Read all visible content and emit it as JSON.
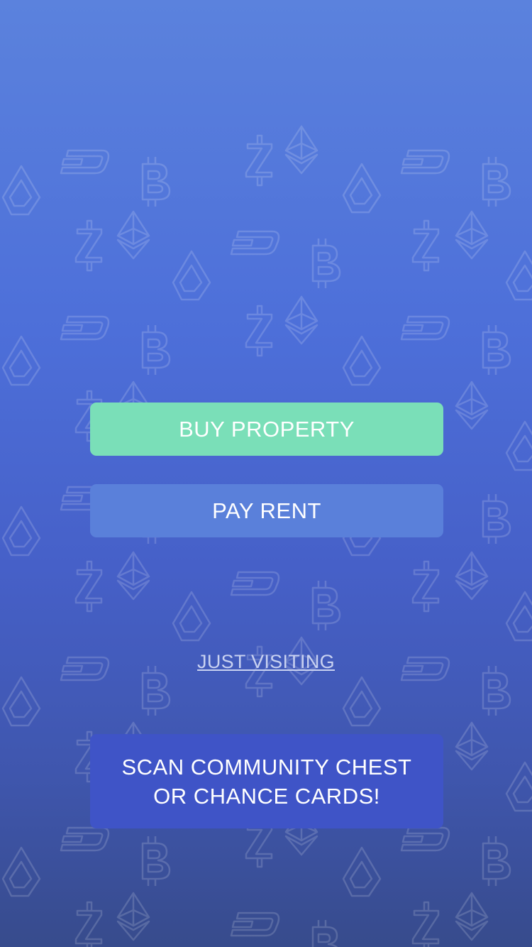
{
  "actions": {
    "buy_property": "BUY PROPERTY",
    "pay_rent": "PAY RENT",
    "just_visiting": "JUST VISITING",
    "scan_line1": "SCAN COMMUNITY CHEST",
    "scan_line2": "OR CHANCE CARDS!"
  },
  "colors": {
    "buy_button": "#7adfb8",
    "rent_button": "#5a80da",
    "scan_button": "#3f54c7",
    "background_top": "#5b82dd",
    "background_bottom": "#374b8c"
  },
  "background_icons": [
    "bitcoin-icon",
    "ethereum-icon",
    "dash-icon",
    "zcash-icon",
    "lisk-icon"
  ]
}
